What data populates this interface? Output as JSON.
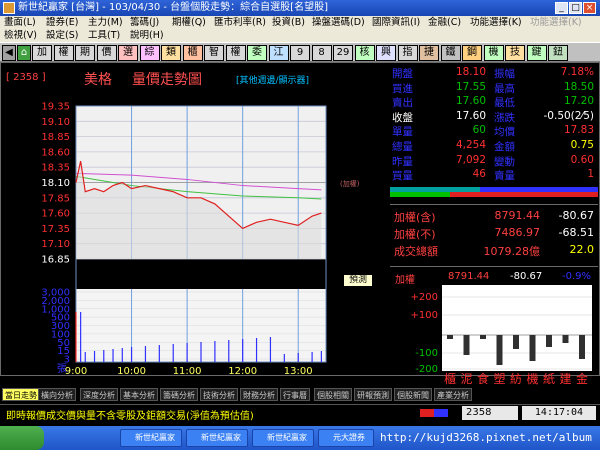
{
  "window": {
    "title": "新世紀贏家 [台灣] - 103/04/30 - 台盤個股走勢：綜合自選股[名望股]"
  },
  "menu1": [
    "畫面(L)",
    "證券(E)",
    "主力(M)",
    "籌碼(J)",
    "期權(Q)",
    "匯市利率(R)",
    "投資(B)",
    "操盤選碼(D)",
    "國際資訊(I)",
    "金融(C)",
    "功能選擇(K)",
    "功能選擇(K)"
  ],
  "menu2": [
    "檢視(V)",
    "設定(S)",
    "工具(T)",
    "說明(H)"
  ],
  "toolbar": [
    "加",
    "權",
    "期",
    "價",
    "選",
    "綜",
    "類",
    "櫃",
    "智",
    "權",
    "委",
    "江",
    "9",
    "8",
    "29",
    "核",
    "興",
    "指",
    "捷",
    "鐵",
    "鋼",
    "機",
    "技",
    "鍵",
    "鈕"
  ],
  "stock": {
    "code": "[ 2358 ]",
    "name": "美格",
    "chart_title": "量價走勢圖",
    "hint": "[其他週邊/顯示器]",
    "ref_label": "(加權)",
    "predict": "預測"
  },
  "price_axis": [
    "19.35",
    "19.10",
    "18.85",
    "18.60",
    "18.35",
    "18.10",
    "17.85",
    "17.60",
    "17.35",
    "17.10",
    "16.85"
  ],
  "volume_axis": [
    "3,000",
    "2,000",
    "1,000",
    "500",
    "300",
    "100",
    "50",
    "15",
    "3"
  ],
  "volume_unit": "張",
  "time_axis": [
    "9:00",
    "10:00",
    "11:00",
    "12:00",
    "13:00"
  ],
  "quote": [
    [
      "開盤",
      "18.10",
      "振幅",
      "7.18%"
    ],
    [
      "買進",
      "17.55",
      "最高",
      "18.50"
    ],
    [
      "賣出",
      "17.60",
      "最低",
      "17.20"
    ],
    [
      "收盤",
      "17.60",
      "漲跌",
      "-0.50(2⁄5)"
    ],
    [
      "單量",
      "60",
      "均價",
      "17.83"
    ],
    [
      "總量",
      "4,254",
      "金額",
      "0.75"
    ],
    [
      "昨量",
      "7,092",
      "變動",
      "0.60"
    ],
    [
      "買量",
      "46",
      "賣量",
      "1"
    ]
  ],
  "index": [
    [
      "加權(含)",
      "8791.44",
      "-80.67"
    ],
    [
      "加權(不)",
      "7486.97",
      "-68.51"
    ],
    [
      "成交總額",
      "1079.28億",
      "22.0"
    ]
  ],
  "sector": {
    "label": "加權",
    "value": "8791.44",
    "change": "-80.67",
    "pct": "-0.9%",
    "axis": [
      "+200",
      "+100",
      "-100",
      "-200"
    ],
    "names": [
      "櫃",
      "泥",
      "食",
      "塑",
      "紡",
      "機",
      "紙",
      "建",
      "金"
    ]
  },
  "tabs": [
    "當日走勢",
    "橫向分析",
    "深度分析",
    "基本分析",
    "籌碼分析",
    "技術分析",
    "財務分析",
    "行事曆",
    "個股相關",
    "研報預測",
    "個股新聞",
    "產業分析"
  ],
  "status": {
    "ticker": "即時報價成交價與量不含零股及鉅額交易(淨值為預估值)",
    "code": "2358",
    "time": "14:17:04"
  },
  "taskbar": {
    "items": [
      "新世紀贏家",
      "新世紀贏家",
      "新世紀贏家",
      "元大證券"
    ],
    "url": "http://kujd3268.pixnet.net/album"
  },
  "colors": {
    "up": "#ff3030",
    "down": "#00c000",
    "flat": "#ffffff",
    "axis_text": "#ff4040",
    "panel_label": "#2020ff"
  },
  "chart_data": {
    "type": "line",
    "price_line": {
      "x": [
        "9:00",
        "9:05",
        "9:10",
        "9:20",
        "9:30",
        "9:40",
        "9:50",
        "10:00",
        "10:15",
        "10:30",
        "10:45",
        "11:00",
        "11:15",
        "11:30",
        "11:45",
        "12:00",
        "12:15",
        "12:30",
        "12:45",
        "13:00",
        "13:15",
        "13:25"
      ],
      "y": [
        18.1,
        18.45,
        17.95,
        18.0,
        17.95,
        18.05,
        18.1,
        18.0,
        18.05,
        18.0,
        17.95,
        17.85,
        17.85,
        17.75,
        17.55,
        17.35,
        17.45,
        17.5,
        17.45,
        17.4,
        17.55,
        17.6
      ]
    },
    "avg_line": {
      "x": [
        "9:00",
        "10:00",
        "11:00",
        "12:00",
        "13:00",
        "13:25"
      ],
      "y": [
        18.2,
        18.05,
        17.95,
        17.88,
        17.85,
        17.83
      ]
    },
    "ref_line": {
      "x": [
        "9:00",
        "10:00",
        "11:00",
        "12:00",
        "13:00",
        "13:25"
      ],
      "y": [
        18.25,
        18.22,
        18.15,
        18.05,
        18.0,
        17.98
      ]
    },
    "ylim": [
      16.85,
      19.35
    ],
    "ref_price": 18.1
  }
}
